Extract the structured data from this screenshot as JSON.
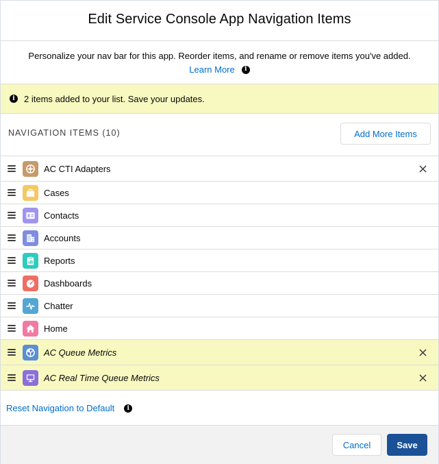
{
  "modal": {
    "title": "Edit Service Console App Navigation Items",
    "intro_text": "Personalize your nav bar for this app. Reorder items, and rename or remove items you've added.",
    "learn_more": "Learn More"
  },
  "toast": {
    "message": "2 items added to your list. Save your updates."
  },
  "list": {
    "header": "NAVIGATION ITEMS (10)",
    "add_button": "Add More Items",
    "items": [
      {
        "label": "AC CTI Adapters",
        "icon": "cti-adapter-icon",
        "color": "#c79a6b",
        "added": false,
        "removable": true
      },
      {
        "label": "Cases",
        "icon": "case-icon",
        "color": "#f4c863",
        "added": false,
        "removable": false
      },
      {
        "label": "Contacts",
        "icon": "contact-icon",
        "color": "#a094ed",
        "added": false,
        "removable": false
      },
      {
        "label": "Accounts",
        "icon": "account-icon",
        "color": "#7f8de1",
        "added": false,
        "removable": false
      },
      {
        "label": "Reports",
        "icon": "report-icon",
        "color": "#2ecbbe",
        "added": false,
        "removable": false
      },
      {
        "label": "Dashboards",
        "icon": "dashboard-icon",
        "color": "#ef6e64",
        "added": false,
        "removable": false
      },
      {
        "label": "Chatter",
        "icon": "chatter-icon",
        "color": "#54a6d4",
        "added": false,
        "removable": false
      },
      {
        "label": "Home",
        "icon": "home-icon",
        "color": "#f17aa3",
        "added": false,
        "removable": false
      },
      {
        "label": "AC Queue Metrics",
        "icon": "queue-metrics-icon",
        "color": "#5b8fd4",
        "added": true,
        "removable": true
      },
      {
        "label": "AC Real Time Queue Metrics",
        "icon": "monitor-icon",
        "color": "#8b6fd8",
        "added": true,
        "removable": true
      }
    ]
  },
  "footer": {
    "reset_link": "Reset Navigation to Default",
    "cancel": "Cancel",
    "save": "Save"
  },
  "colors": {
    "accent": "#006dcc",
    "highlight": "#f7f9c0",
    "brand": "#1b5297"
  }
}
